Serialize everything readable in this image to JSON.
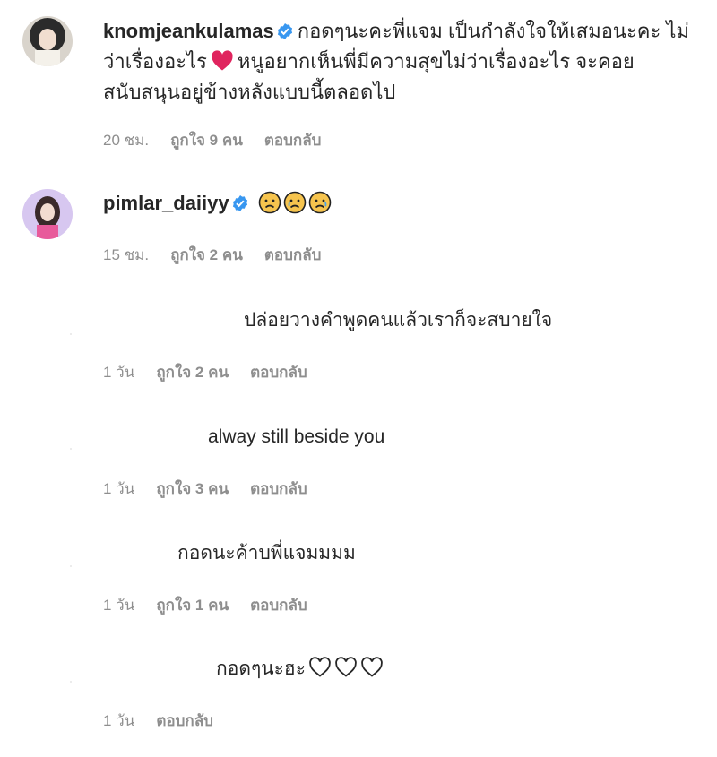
{
  "comments": [
    {
      "username": "knomjeankulamas",
      "text_part1": "กอดๆนะคะพี่แจม เป็นกำลังใจให้เสมอนะคะ ไม่ว่าเรื่องอะไร",
      "text_part2": "หนูอยากเห็นพี่มีความสุขไม่ว่าเรื่องอะไร จะคอยสนับสนุนอยู่ข้างหลังแบบนี้ตลอดไป",
      "time": "20 ชม.",
      "likes": "ถูกใจ 9 คน",
      "reply": "ตอบกลับ"
    },
    {
      "username": "pimlar_daiiyy",
      "time": "15 ชม.",
      "likes": "ถูกใจ 2 คน",
      "reply": "ตอบกลับ"
    }
  ],
  "replies": [
    {
      "text": "ปล่อยวางคำพูดคนแล้วเราก็จะสบายใจ",
      "time": "1 วัน",
      "likes": "ถูกใจ 2 คน",
      "reply": "ตอบกลับ"
    },
    {
      "text": "alway still beside you",
      "time": "1 วัน",
      "likes": "ถูกใจ 3 คน",
      "reply": "ตอบกลับ"
    },
    {
      "text": "กอดนะค้าบพี่แจมมมม",
      "time": "1 วัน",
      "likes": "ถูกใจ 1 คน",
      "reply": "ตอบกลับ"
    },
    {
      "text": "กอดๆนะฮะ",
      "time": "1 วัน",
      "reply": "ตอบกลับ"
    }
  ],
  "icons": {
    "verified": "verified-badge-icon",
    "heart": "red-heart-emoji",
    "sad_face": "sad-face-emoji",
    "outline_heart": "white-heart-outline-icon"
  },
  "colors": {
    "text": "#262626",
    "meta": "#8e8e8e",
    "verified": "#3897f0",
    "heart": "#e0245e"
  }
}
